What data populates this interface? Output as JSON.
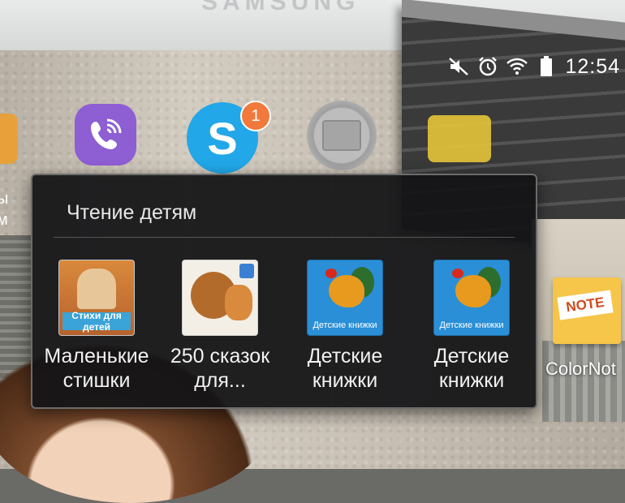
{
  "device": {
    "brand": "SAMSUNG"
  },
  "status_bar": {
    "icons": [
      "mute-icon",
      "alarm-icon",
      "wifi-icon",
      "battery-icon"
    ],
    "time": "12:54"
  },
  "home": {
    "skype_badge": "1",
    "left_edge_label_lines": [
      "ы",
      "м"
    ],
    "note_tag": "NOTE",
    "colornote_label": "ColorNot"
  },
  "folder": {
    "title": "Чтение детям",
    "apps": [
      {
        "label_line1": "Маленькие",
        "label_line2": "стишки",
        "icon_caption": "Стихи для детей"
      },
      {
        "label_line1": "250 сказок",
        "label_line2": "для..."
      },
      {
        "label_line1": "Детские",
        "label_line2": "книжки",
        "icon_caption": "Детские книжки"
      },
      {
        "label_line1": "Детские",
        "label_line2": "книжки",
        "icon_caption": "Детские книжки"
      }
    ]
  },
  "colors": {
    "popup_bg": "#141416",
    "viber": "#8e5ed3",
    "skype": "#22a7e8",
    "badge": "#f2793c",
    "note": "#f5c64a"
  }
}
